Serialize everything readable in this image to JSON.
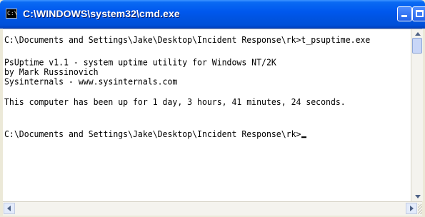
{
  "window": {
    "title": "C:\\WINDOWS\\system32\\cmd.exe",
    "icon": "cmd-console-icon"
  },
  "titlebar_buttons": {
    "minimize_icon": "minimize-icon",
    "maximize_icon": "maximize-icon",
    "close_icon": "close-icon"
  },
  "console": {
    "lines": [
      "C:\\Documents and Settings\\Jake\\Desktop\\Incident Response\\rk>t_psuptime.exe",
      "",
      "PsUptime v1.1 - system uptime utility for Windows NT/2K",
      "by Mark Russinovich",
      "Sysinternals - www.sysinternals.com",
      "",
      "This computer has been up for 1 day, 3 hours, 41 minutes, 24 seconds.",
      "",
      "",
      "C:\\Documents and Settings\\Jake\\Desktop\\Incident Response\\rk>"
    ]
  },
  "colors": {
    "titlebar": "#0054e3",
    "console_background": "#ffffff",
    "console_text": "#000000"
  }
}
